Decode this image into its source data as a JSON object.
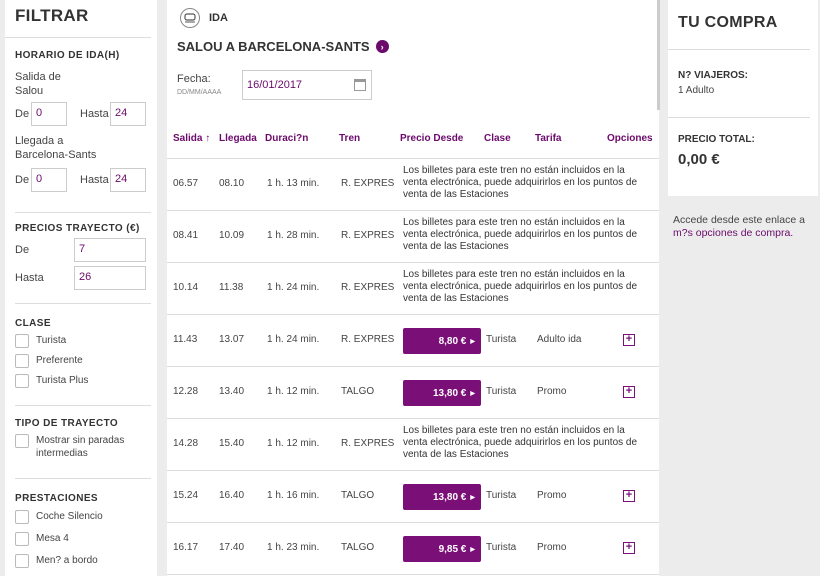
{
  "filters": {
    "title": "FILTRAR",
    "horario": {
      "heading": "HORARIO DE IDA(H)",
      "salida_label": "Salida de Salou",
      "llegada_label": "Llegada a Barcelona-Sants",
      "de": "De",
      "hasta": "Hasta",
      "salida_de": "0",
      "salida_hasta": "24",
      "llegada_de": "0",
      "llegada_hasta": "24"
    },
    "precios": {
      "heading": "PRECIOS TRAYECTO (€)",
      "de": "De",
      "hasta": "Hasta",
      "de_value": "7",
      "hasta_value": "26"
    },
    "clase": {
      "heading": "CLASE",
      "options": [
        "Turista",
        "Preferente",
        "Turista Plus"
      ]
    },
    "tipo": {
      "heading": "TIPO DE TRAYECTO",
      "options": [
        "Mostrar sin paradas intermedias"
      ]
    },
    "prestaciones": {
      "heading": "PRESTACIONES",
      "options": [
        "Coche Silencio",
        "Mesa 4",
        "Men? a bordo"
      ]
    }
  },
  "journey": {
    "direction": "IDA",
    "route": "SALOU A BARCELONA-SANTS",
    "fecha_label": "Fecha:",
    "fecha_format": "DD/MM/AAAA",
    "fecha_value": "16/01/2017"
  },
  "table": {
    "headers": {
      "salida": "Salida ↑",
      "llegada": "Llegada",
      "duracion": "Duraci?n",
      "tren": "Tren",
      "precio": "Precio Desde",
      "clase": "Clase",
      "tarifa": "Tarifa",
      "opciones": "Opciones"
    },
    "rows": [
      {
        "salida": "06.57",
        "llegada": "08.10",
        "duracion": "1 h. 13 min.",
        "tren": "R. EXPRES",
        "note": "Los billetes para este tren no están incluidos en la venta electrónica, puede adquirirlos en los puntos de venta de las Estaciones"
      },
      {
        "salida": "08.41",
        "llegada": "10.09",
        "duracion": "1 h. 28 min.",
        "tren": "R. EXPRES",
        "note": "Los billetes para este tren no están incluidos en la venta electrónica, puede adquirirlos en los puntos de venta de las Estaciones"
      },
      {
        "salida": "10.14",
        "llegada": "11.38",
        "duracion": "1 h. 24 min.",
        "tren": "R. EXPRES",
        "note": "Los billetes para este tren no están incluidos en la venta electrónica, puede adquirirlos en los puntos de venta de las Estaciones"
      },
      {
        "salida": "11.43",
        "llegada": "13.07",
        "duracion": "1 h. 24 min.",
        "tren": "R. EXPRES",
        "precio": "8,80 €",
        "clase": "Turista",
        "tarifa": "Adulto ida"
      },
      {
        "salida": "12.28",
        "llegada": "13.40",
        "duracion": "1 h. 12 min.",
        "tren": "TALGO",
        "precio": "13,80 €",
        "clase": "Turista",
        "tarifa": "Promo"
      },
      {
        "salida": "14.28",
        "llegada": "15.40",
        "duracion": "1 h. 12 min.",
        "tren": "R. EXPRES",
        "note": "Los billetes para este tren no están incluidos en la venta electrónica, puede adquirirlos en los puntos de venta de las Estaciones"
      },
      {
        "salida": "15.24",
        "llegada": "16.40",
        "duracion": "1 h. 16 min.",
        "tren": "TALGO",
        "precio": "13,80 €",
        "clase": "Turista",
        "tarifa": "Promo"
      },
      {
        "salida": "16.17",
        "llegada": "17.40",
        "duracion": "1 h. 23 min.",
        "tren": "TALGO",
        "precio": "9,85 €",
        "clase": "Turista",
        "tarifa": "Promo"
      }
    ]
  },
  "cart": {
    "title": "TU COMPRA",
    "viajeros_label": "N? VIAJEROS:",
    "viajeros_value": "1 Adulto",
    "total_label": "PRECIO TOTAL:",
    "total_value": "0,00 €",
    "more_text": "Accede desde este enlace a",
    "more_link": "m?s opciones de compra."
  },
  "colors": {
    "accent": "#7a0f77"
  }
}
